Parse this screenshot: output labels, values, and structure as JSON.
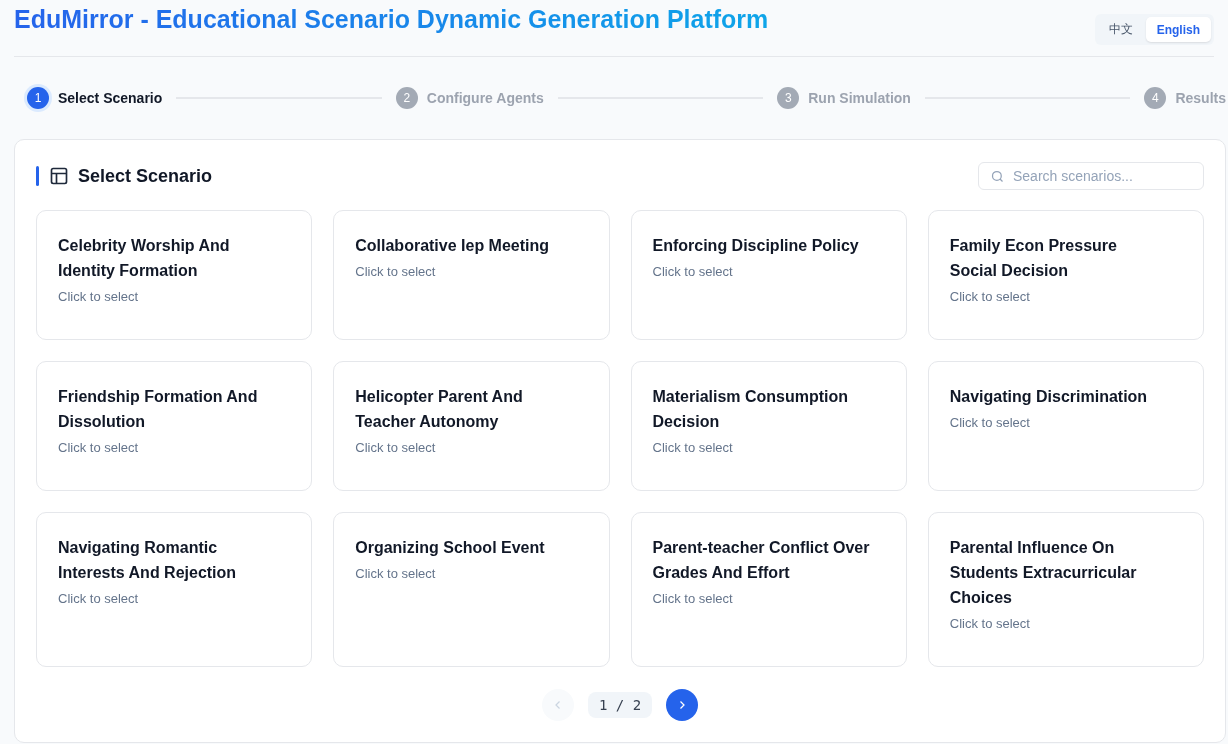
{
  "header": {
    "title": "EduMirror - Educational Scenario Dynamic Generation Platform",
    "languages": [
      {
        "label": "中文",
        "selected": false
      },
      {
        "label": "English",
        "selected": true
      }
    ]
  },
  "steps": [
    {
      "number": "1",
      "label": "Select Scenario",
      "selected": true
    },
    {
      "number": "2",
      "label": "Configure Agents",
      "selected": false
    },
    {
      "number": "3",
      "label": "Run Simulation",
      "selected": false
    },
    {
      "number": "4",
      "label": "Results",
      "selected": false
    }
  ],
  "panel": {
    "title": "Select Scenario",
    "search": {
      "placeholder": "Search scenarios..."
    },
    "scenarios": [
      {
        "title": "Celebrity Worship And Identity Formation",
        "hint": "Click to select"
      },
      {
        "title": "Collaborative Iep Meeting",
        "hint": "Click to select"
      },
      {
        "title": "Enforcing Discipline Policy",
        "hint": "Click to select"
      },
      {
        "title": "Family Econ Pressure Social Decision",
        "hint": "Click to select"
      },
      {
        "title": "Friendship Formation And Dissolution",
        "hint": "Click to select"
      },
      {
        "title": "Helicopter Parent And Teacher Autonomy",
        "hint": "Click to select"
      },
      {
        "title": "Materialism Consumption Decision",
        "hint": "Click to select"
      },
      {
        "title": "Navigating Discrimination",
        "hint": "Click to select"
      },
      {
        "title": "Navigating Romantic Interests And Rejection",
        "hint": "Click to select"
      },
      {
        "title": "Organizing School Event",
        "hint": "Click to select"
      },
      {
        "title": "Parent-teacher Conflict Over Grades And Effort",
        "hint": "Click to select"
      },
      {
        "title": "Parental Influence On Students Extracurricular Choices",
        "hint": "Click to select"
      }
    ],
    "pagination": {
      "page": "1 / 2",
      "prev_disabled": true,
      "next_disabled": false
    }
  }
}
